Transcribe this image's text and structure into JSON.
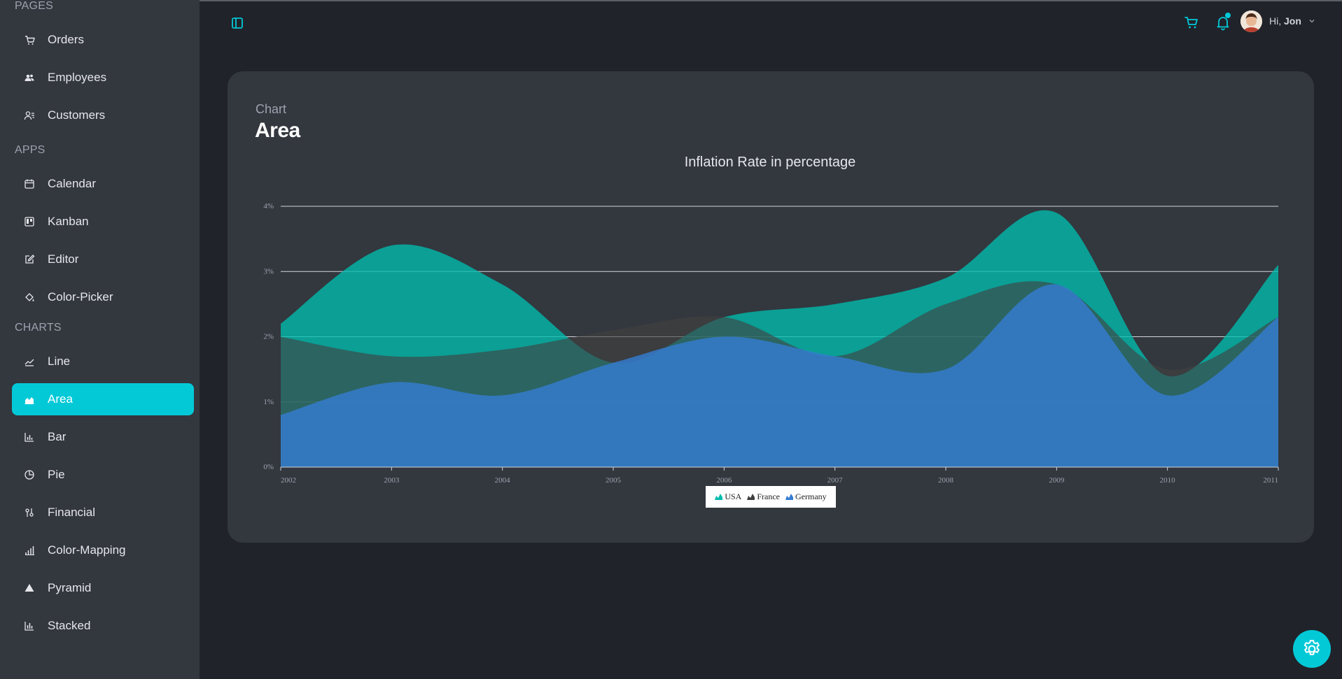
{
  "sidebar": {
    "sections": [
      {
        "title": "PAGES",
        "items": [
          {
            "label": "Orders",
            "icon": "cart-icon"
          },
          {
            "label": "Employees",
            "icon": "users-icon"
          },
          {
            "label": "Customers",
            "icon": "user-list-icon"
          }
        ]
      },
      {
        "title": "APPS",
        "items": [
          {
            "label": "Calendar",
            "icon": "calendar-icon"
          },
          {
            "label": "Kanban",
            "icon": "kanban-icon"
          },
          {
            "label": "Editor",
            "icon": "edit-icon"
          },
          {
            "label": "Color-Picker",
            "icon": "paint-bucket-icon"
          }
        ]
      },
      {
        "title": "CHARTS",
        "items": [
          {
            "label": "Line",
            "icon": "line-chart-icon"
          },
          {
            "label": "Area",
            "icon": "area-chart-icon",
            "active": true
          },
          {
            "label": "Bar",
            "icon": "bar-chart-icon"
          },
          {
            "label": "Pie",
            "icon": "pie-chart-icon"
          },
          {
            "label": "Financial",
            "icon": "financial-icon"
          },
          {
            "label": "Color-Mapping",
            "icon": "color-mapping-icon"
          },
          {
            "label": "Pyramid",
            "icon": "pyramid-icon"
          },
          {
            "label": "Stacked",
            "icon": "stacked-chart-icon"
          }
        ]
      }
    ]
  },
  "header": {
    "greeting": "Hi,",
    "user_name": "Jon"
  },
  "card": {
    "subtitle": "Chart",
    "title": "Area"
  },
  "colors": {
    "accent": "#03c9d7",
    "usa": "#00bdae",
    "france": "#404041",
    "germany": "#357cd2"
  },
  "chart_data": {
    "type": "area",
    "title": "Inflation Rate in percentage",
    "x": [
      "2002",
      "2003",
      "2004",
      "2005",
      "2006",
      "2007",
      "2008",
      "2009",
      "2010",
      "2011"
    ],
    "ylim": [
      0,
      4
    ],
    "yticks": [
      "0%",
      "1%",
      "2%",
      "3%",
      "4%"
    ],
    "grid": true,
    "legend_position": "bottom",
    "series": [
      {
        "name": "USA",
        "values": [
          2.2,
          3.4,
          2.8,
          1.6,
          2.3,
          2.5,
          2.9,
          3.9,
          1.4,
          3.1
        ]
      },
      {
        "name": "France",
        "values": [
          2.0,
          1.7,
          1.8,
          2.1,
          2.3,
          1.7,
          2.5,
          2.8,
          1.5,
          2.3
        ]
      },
      {
        "name": "Germany",
        "values": [
          0.8,
          1.3,
          1.1,
          1.6,
          2.0,
          1.7,
          1.5,
          2.8,
          1.1,
          2.3
        ]
      }
    ]
  }
}
